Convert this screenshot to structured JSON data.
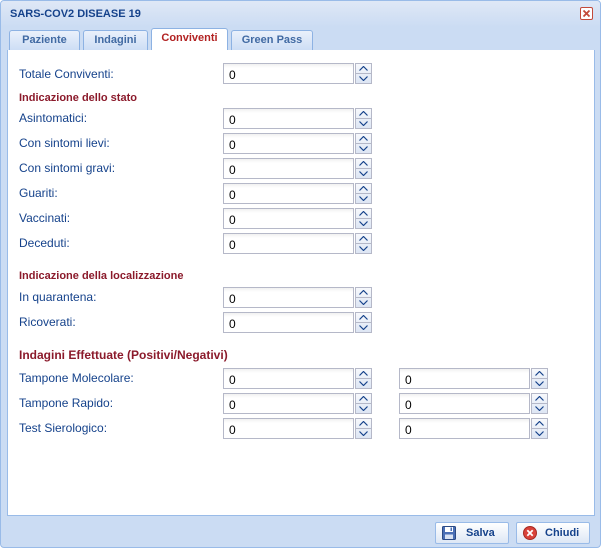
{
  "window": {
    "title": "SARS-COV2 DISEASE 19"
  },
  "tabs": [
    {
      "label": "Paziente",
      "active": false
    },
    {
      "label": "Indagini",
      "active": false
    },
    {
      "label": "Conviventi",
      "active": true
    },
    {
      "label": "Green Pass",
      "active": false
    }
  ],
  "form": {
    "totale_conviventi": {
      "label": "Totale Conviventi:",
      "value": "0"
    },
    "stato": {
      "heading": "Indicazione dello stato",
      "fields": [
        {
          "label": "Asintomatici:",
          "value": "0"
        },
        {
          "label": "Con sintomi lievi:",
          "value": "0"
        },
        {
          "label": "Con sintomi gravi:",
          "value": "0"
        },
        {
          "label": "Guariti:",
          "value": "0"
        },
        {
          "label": "Vaccinati:",
          "value": "0"
        },
        {
          "label": "Deceduti:",
          "value": "0"
        }
      ]
    },
    "localizzazione": {
      "heading": "Indicazione della localizzazione",
      "fields": [
        {
          "label": "In quarantena:",
          "value": "0"
        },
        {
          "label": "Ricoverati:",
          "value": "0"
        }
      ]
    },
    "indagini": {
      "heading": "Indagini Effettuate (Positivi/Negativi)",
      "fields": [
        {
          "label": "Tampone Molecolare:",
          "positivi": "0",
          "negativi": "0"
        },
        {
          "label": "Tampone Rapido:",
          "positivi": "0",
          "negativi": "0"
        },
        {
          "label": "Test Sierologico:",
          "positivi": "0",
          "negativi": "0"
        }
      ]
    }
  },
  "footer": {
    "save_label": "Salva",
    "close_label": "Chiudi"
  },
  "colors": {
    "accent": "#15428b",
    "section_heading": "#8b1a2b",
    "active_tab_text": "#b22222",
    "window_frame": "#cbdcf3"
  },
  "icons": {
    "close": "close-icon",
    "save": "floppy-disk-icon",
    "cancel": "cancel-circle-icon",
    "spinner_up": "chevron-up-icon",
    "spinner_down": "chevron-down-icon"
  }
}
